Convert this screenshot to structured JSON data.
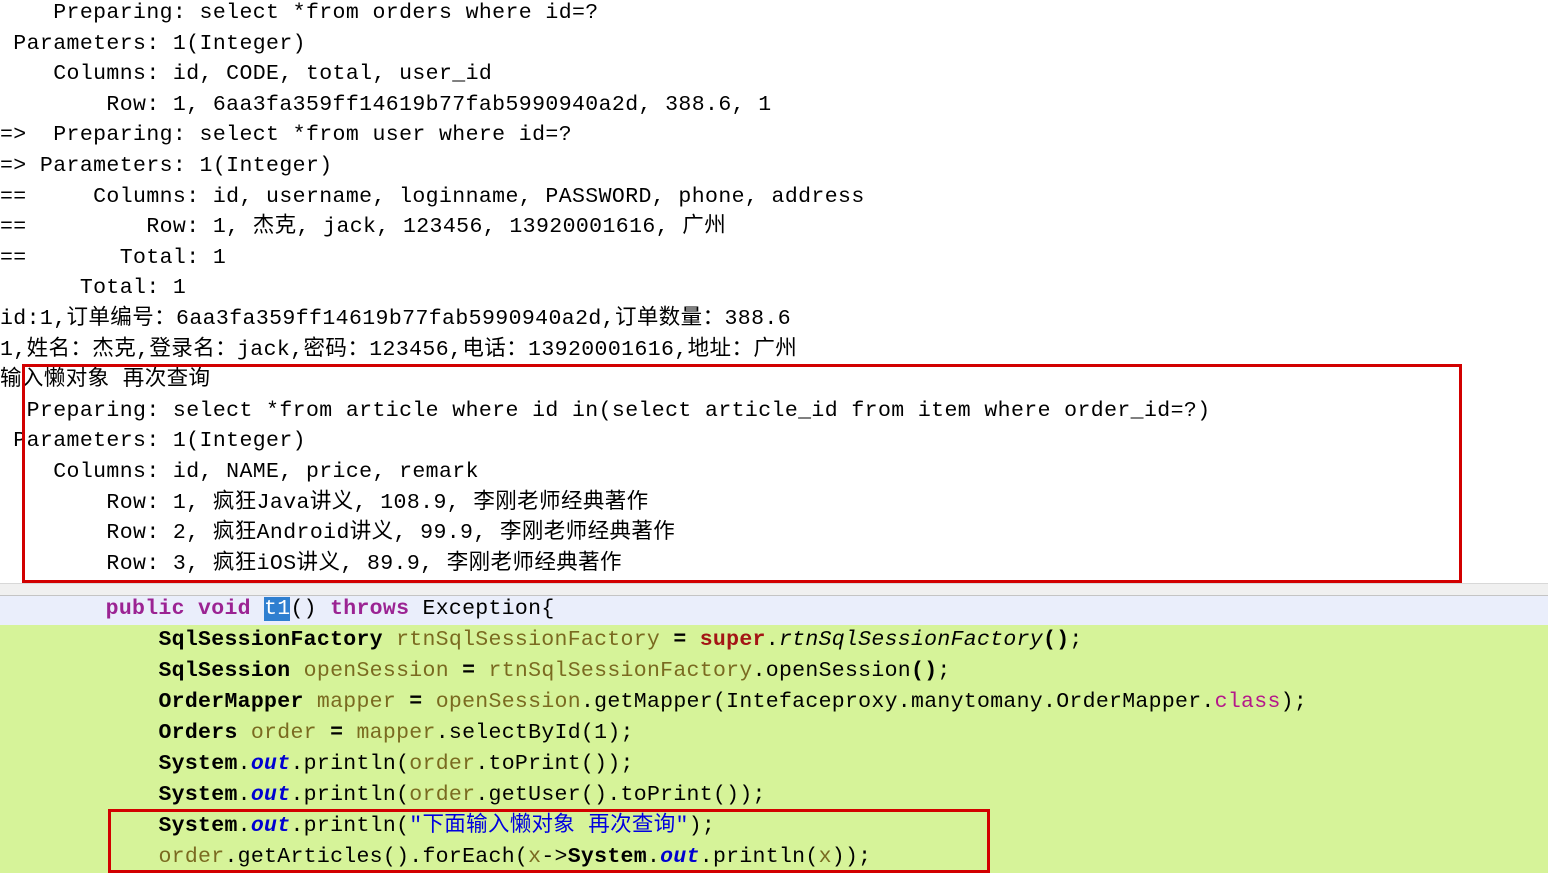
{
  "console": {
    "name": "mybatis-sql-log-console",
    "lines": [
      "    Preparing: select *from orders where id=?",
      " Parameters: 1(Integer)",
      "    Columns: id, CODE, total, user_id",
      "        Row: 1, 6aa3fa359ff14619b77fab5990940a2d, 388.6, 1",
      "=>  Preparing: select *from user where id=?",
      "=> Parameters: 1(Integer)",
      "==     Columns: id, username, loginname, PASSWORD, phone, address",
      "==         Row: 1, 杰克, jack, 123456, 13920001616, 广州",
      "==       Total: 1",
      "      Total: 1",
      "id:1,订单编号：6aa3fa359ff14619b77fab5990940a2d,订单数量：388.6",
      "1,姓名：杰克,登录名：jack,密码：123456,电话：13920001616,地址：广州",
      "输入懒对象 再次查询",
      "  Preparing: select *from article where id in(select article_id from item where order_id=?)",
      " Parameters: 1(Integer)",
      "    Columns: id, NAME, price, remark",
      "        Row: 1, 疯狂Java讲义, 108.9, 李刚老师经典著作",
      "        Row: 2, 疯狂Android讲义, 99.9, 李刚老师经典著作",
      "        Row: 3, 疯狂iOS讲义, 89.9, 李刚老师经典著作"
    ]
  },
  "annotations": {
    "top_box_label": "lazy-load-second-query-highlight",
    "bottom_box_label": "lazy-load-code-highlight",
    "box_color": "#d20000"
  },
  "editor": {
    "name": "java-test-method-editor",
    "background_selection_color": "#d6f399",
    "current_line_color": "#eaeefb",
    "lines": [
      {
        "id": "method-signature",
        "state": "current",
        "tokens": [
          {
            "cls": "plain",
            "t": "        "
          },
          {
            "cls": "kw",
            "t": "public void "
          },
          {
            "cls": "selname",
            "t": "t1"
          },
          {
            "cls": "plain",
            "t": "() "
          },
          {
            "cls": "kw",
            "t": "throws "
          },
          {
            "cls": "plain",
            "t": "Exception{"
          }
        ]
      },
      {
        "id": "sqlsessionfactory-decl",
        "state": "sel",
        "tokens": [
          {
            "cls": "plain",
            "t": "            "
          },
          {
            "cls": "type",
            "t": "SqlSessionFactory"
          },
          {
            "cls": "plain",
            "t": " "
          },
          {
            "cls": "var",
            "t": "rtnSqlSessionFactory"
          },
          {
            "cls": "plain",
            "t": " "
          },
          {
            "cls": "type",
            "t": "="
          },
          {
            "cls": "plain",
            "t": " "
          },
          {
            "cls": "kw2",
            "t": "super"
          },
          {
            "cls": "plain",
            "t": "."
          },
          {
            "cls": "mi",
            "t": "rtnSqlSessionFactory"
          },
          {
            "cls": "type",
            "t": "()"
          },
          {
            "cls": "plain",
            "t": ";"
          }
        ]
      },
      {
        "id": "opensession-decl",
        "state": "sel",
        "tokens": [
          {
            "cls": "plain",
            "t": "            "
          },
          {
            "cls": "type",
            "t": "SqlSession"
          },
          {
            "cls": "plain",
            "t": " "
          },
          {
            "cls": "var",
            "t": "openSession"
          },
          {
            "cls": "plain",
            "t": " "
          },
          {
            "cls": "type",
            "t": "="
          },
          {
            "cls": "plain",
            "t": " "
          },
          {
            "cls": "var",
            "t": "rtnSqlSessionFactory"
          },
          {
            "cls": "plain",
            "t": ".openSession"
          },
          {
            "cls": "type",
            "t": "()"
          },
          {
            "cls": "plain",
            "t": ";"
          }
        ]
      },
      {
        "id": "ordermapper-decl",
        "state": "sel",
        "tokens": [
          {
            "cls": "plain",
            "t": "            "
          },
          {
            "cls": "type",
            "t": "OrderMapper"
          },
          {
            "cls": "plain",
            "t": " "
          },
          {
            "cls": "var",
            "t": "mapper"
          },
          {
            "cls": "plain",
            "t": " "
          },
          {
            "cls": "type",
            "t": "="
          },
          {
            "cls": "plain",
            "t": " "
          },
          {
            "cls": "var",
            "t": "openSession"
          },
          {
            "cls": "plain",
            "t": ".getMapper(Intefaceproxy.manytomany.OrderMapper."
          },
          {
            "cls": "kwcls",
            "t": "class"
          },
          {
            "cls": "plain",
            "t": ");"
          }
        ]
      },
      {
        "id": "orders-decl",
        "state": "sel",
        "tokens": [
          {
            "cls": "plain",
            "t": "            "
          },
          {
            "cls": "type",
            "t": "Orders"
          },
          {
            "cls": "plain",
            "t": " "
          },
          {
            "cls": "var",
            "t": "order"
          },
          {
            "cls": "plain",
            "t": " "
          },
          {
            "cls": "type",
            "t": "="
          },
          {
            "cls": "plain",
            "t": " "
          },
          {
            "cls": "var",
            "t": "mapper"
          },
          {
            "cls": "plain",
            "t": ".selectById(1);"
          }
        ]
      },
      {
        "id": "print-order",
        "state": "sel",
        "tokens": [
          {
            "cls": "plain",
            "t": "            "
          },
          {
            "cls": "type",
            "t": "System"
          },
          {
            "cls": "plain",
            "t": "."
          },
          {
            "cls": "fld",
            "t": "out"
          },
          {
            "cls": "plain",
            "t": ".println("
          },
          {
            "cls": "var",
            "t": "order"
          },
          {
            "cls": "plain",
            "t": ".toPrint());"
          }
        ]
      },
      {
        "id": "print-order-user",
        "state": "sel",
        "tokens": [
          {
            "cls": "plain",
            "t": "            "
          },
          {
            "cls": "type",
            "t": "System"
          },
          {
            "cls": "plain",
            "t": "."
          },
          {
            "cls": "fld",
            "t": "out"
          },
          {
            "cls": "plain",
            "t": ".println("
          },
          {
            "cls": "var",
            "t": "order"
          },
          {
            "cls": "plain",
            "t": ".getUser().toPrint());"
          }
        ]
      },
      {
        "id": "print-lazy-hint",
        "state": "sel",
        "tokens": [
          {
            "cls": "plain",
            "t": "            "
          },
          {
            "cls": "type",
            "t": "System"
          },
          {
            "cls": "plain",
            "t": "."
          },
          {
            "cls": "fld",
            "t": "out"
          },
          {
            "cls": "plain",
            "t": ".println("
          },
          {
            "cls": "str",
            "t": "\"下面输入懒对象 再次查询\""
          },
          {
            "cls": "plain",
            "t": ");"
          }
        ]
      },
      {
        "id": "foreach-articles",
        "state": "sel",
        "tokens": [
          {
            "cls": "plain",
            "t": "            "
          },
          {
            "cls": "var",
            "t": "order"
          },
          {
            "cls": "plain",
            "t": ".getArticles().forEach("
          },
          {
            "cls": "var",
            "t": "x"
          },
          {
            "cls": "plain",
            "t": "->"
          },
          {
            "cls": "type",
            "t": "System"
          },
          {
            "cls": "plain",
            "t": "."
          },
          {
            "cls": "fld",
            "t": "out"
          },
          {
            "cls": "plain",
            "t": ".println("
          },
          {
            "cls": "var",
            "t": "x"
          },
          {
            "cls": "plain",
            "t": "));"
          }
        ]
      }
    ]
  }
}
